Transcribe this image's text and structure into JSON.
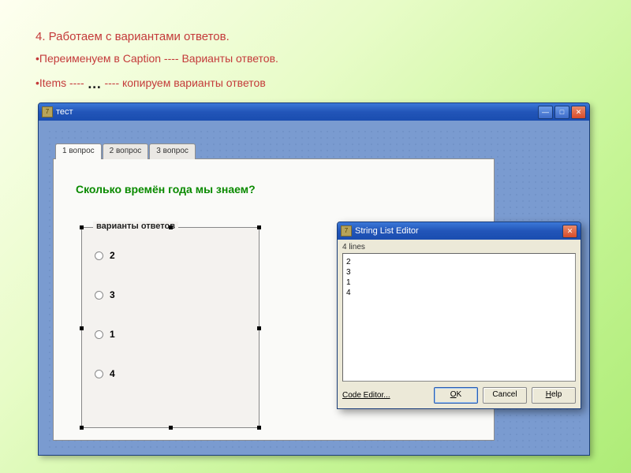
{
  "instructions": {
    "line1": "4. Работаем с вариантами ответов.",
    "line2": "•Переименуем в Caption ---- Варианты ответов.",
    "line3_a": "•Items ---- ",
    "line3_ellipsis": "…",
    "line3_b": " ---- копируем варианты ответов"
  },
  "ide": {
    "title": "тест",
    "tabs": [
      "1 вопрос",
      "2 вопрос",
      "3 вопрос"
    ],
    "question": "Сколько времён года мы знаем?",
    "radiogroup_caption": "варианты ответов",
    "options": [
      "2",
      "3",
      "1",
      "4"
    ]
  },
  "editor": {
    "title": "String List Editor",
    "line_count": "4 lines",
    "lines": [
      "2",
      "3",
      "1",
      "4"
    ],
    "code_editor": "Code Editor...",
    "ok": "OK",
    "cancel": "Cancel",
    "help": "Help"
  }
}
